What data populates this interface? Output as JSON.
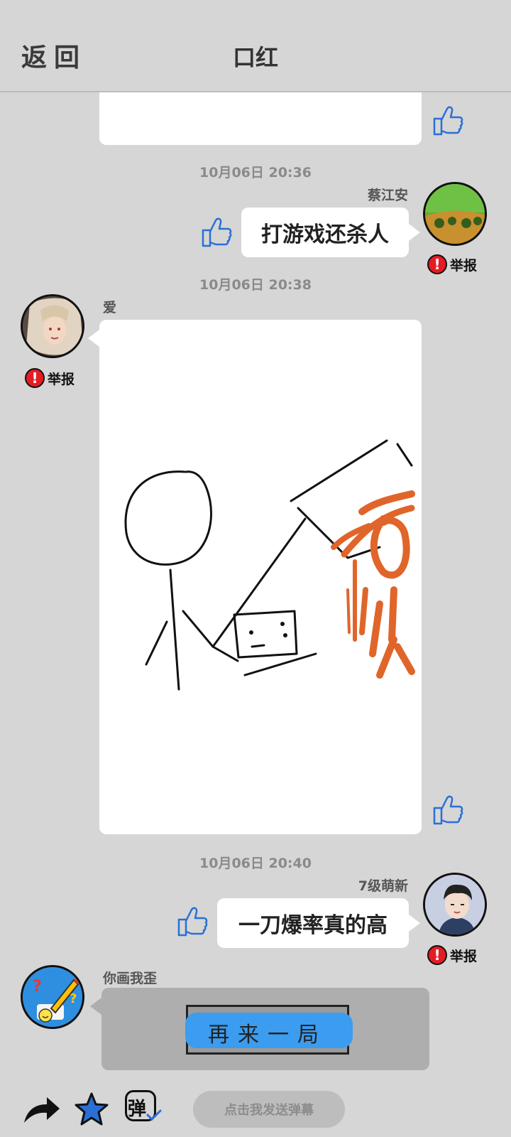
{
  "header": {
    "back_label": "返回",
    "title": "口红"
  },
  "messages": [
    {
      "time": "10月06日 20:36",
      "sender": "蔡江安",
      "text": "打游戏还杀人",
      "report_label": "举报"
    },
    {
      "time": "10月06日 20:38",
      "sender": "爱",
      "report_label": "举报"
    },
    {
      "time": "10月06日 20:40",
      "sender": "7级萌新",
      "text": "一刀爆率真的高",
      "report_label": "举报"
    },
    {
      "sender": "你画我歪",
      "button_label": "再来一局"
    }
  ],
  "bottom": {
    "danmu_placeholder": "点击我发送弹幕",
    "danmu_icon_char": "弹"
  },
  "colors": {
    "background": "#d6d6d6",
    "thumb_blue": "#2a6fd6",
    "report_red": "#e51c23",
    "orange": "#e0652a",
    "button_blue": "#3b9cf0"
  },
  "icons": [
    "thumbs-up-icon",
    "alert-icon",
    "share-icon",
    "star-icon",
    "danmu-icon"
  ]
}
